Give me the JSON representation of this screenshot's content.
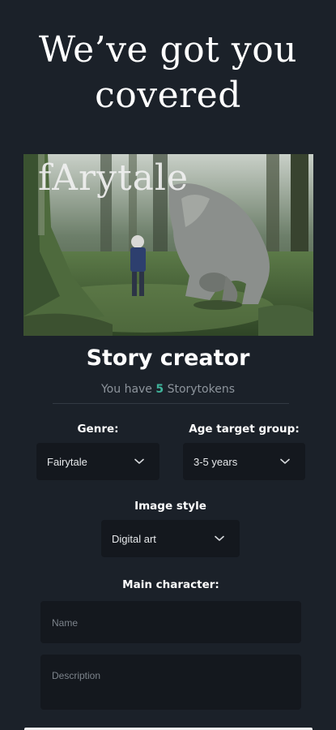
{
  "headline": "We’ve got you covered",
  "hero": {
    "overlay_text": "fArytale"
  },
  "creator": {
    "title": "Story creator",
    "tokens_prefix": "You have",
    "tokens_count": "5",
    "tokens_suffix": "Storytokens"
  },
  "genre": {
    "label": "Genre:",
    "value": "Fairytale"
  },
  "age_group": {
    "label": "Age target group:",
    "value": "3-5 years"
  },
  "image_style": {
    "label": "Image style",
    "value": "Digital art"
  },
  "main_character": {
    "label": "Main character:",
    "name_placeholder": "Name",
    "description_placeholder": "Description"
  },
  "colors": {
    "background": "#1b2129",
    "field": "#14181e",
    "accent": "#3fb39a"
  },
  "icons": [
    "chevron-down-icon"
  ]
}
